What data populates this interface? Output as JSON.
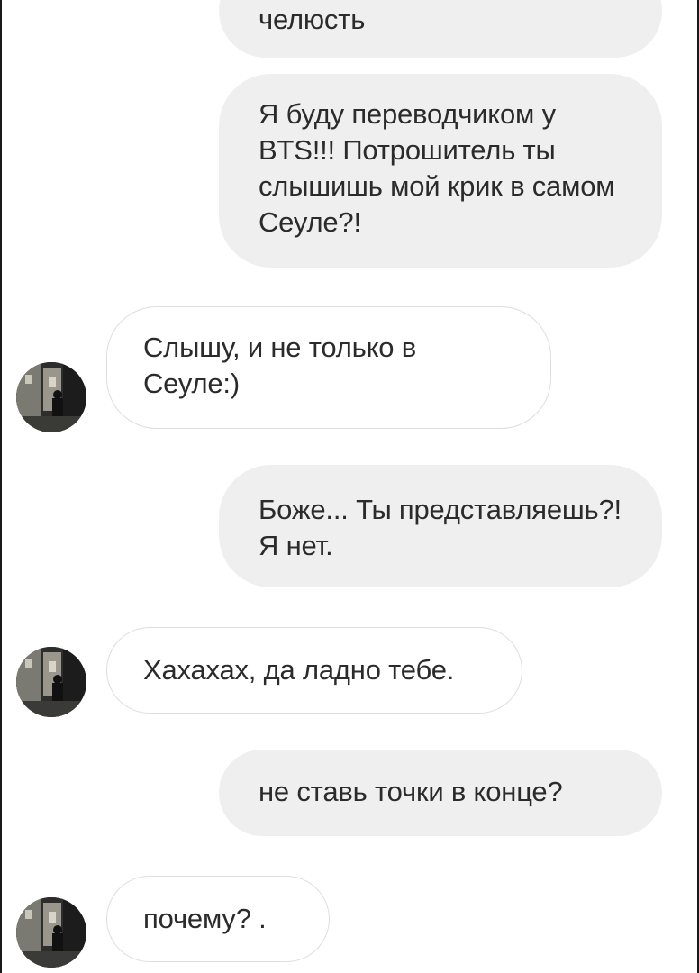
{
  "messages": [
    {
      "sender": "me",
      "text": "челюсть"
    },
    {
      "sender": "me",
      "text": "Я буду переводчиком у BTS!!! Потрошитель ты слышишь мой крик в самом Сеуле?!"
    },
    {
      "sender": "contact",
      "text": "Слышу, и не только в Сеуле:)"
    },
    {
      "sender": "me",
      "text": "Боже... Ты представляешь?! Я нет."
    },
    {
      "sender": "contact",
      "text": "Хахахах, да ладно тебе."
    },
    {
      "sender": "me",
      "text": "не ставь точки в конце?"
    },
    {
      "sender": "contact",
      "text": "почему? ."
    }
  ],
  "colors": {
    "outgoing_bubble": "#efeff0",
    "incoming_bubble_border": "#dedede",
    "text": "#2b2b2b"
  },
  "icons": {
    "contact_avatar": "contact-avatar-photo"
  }
}
